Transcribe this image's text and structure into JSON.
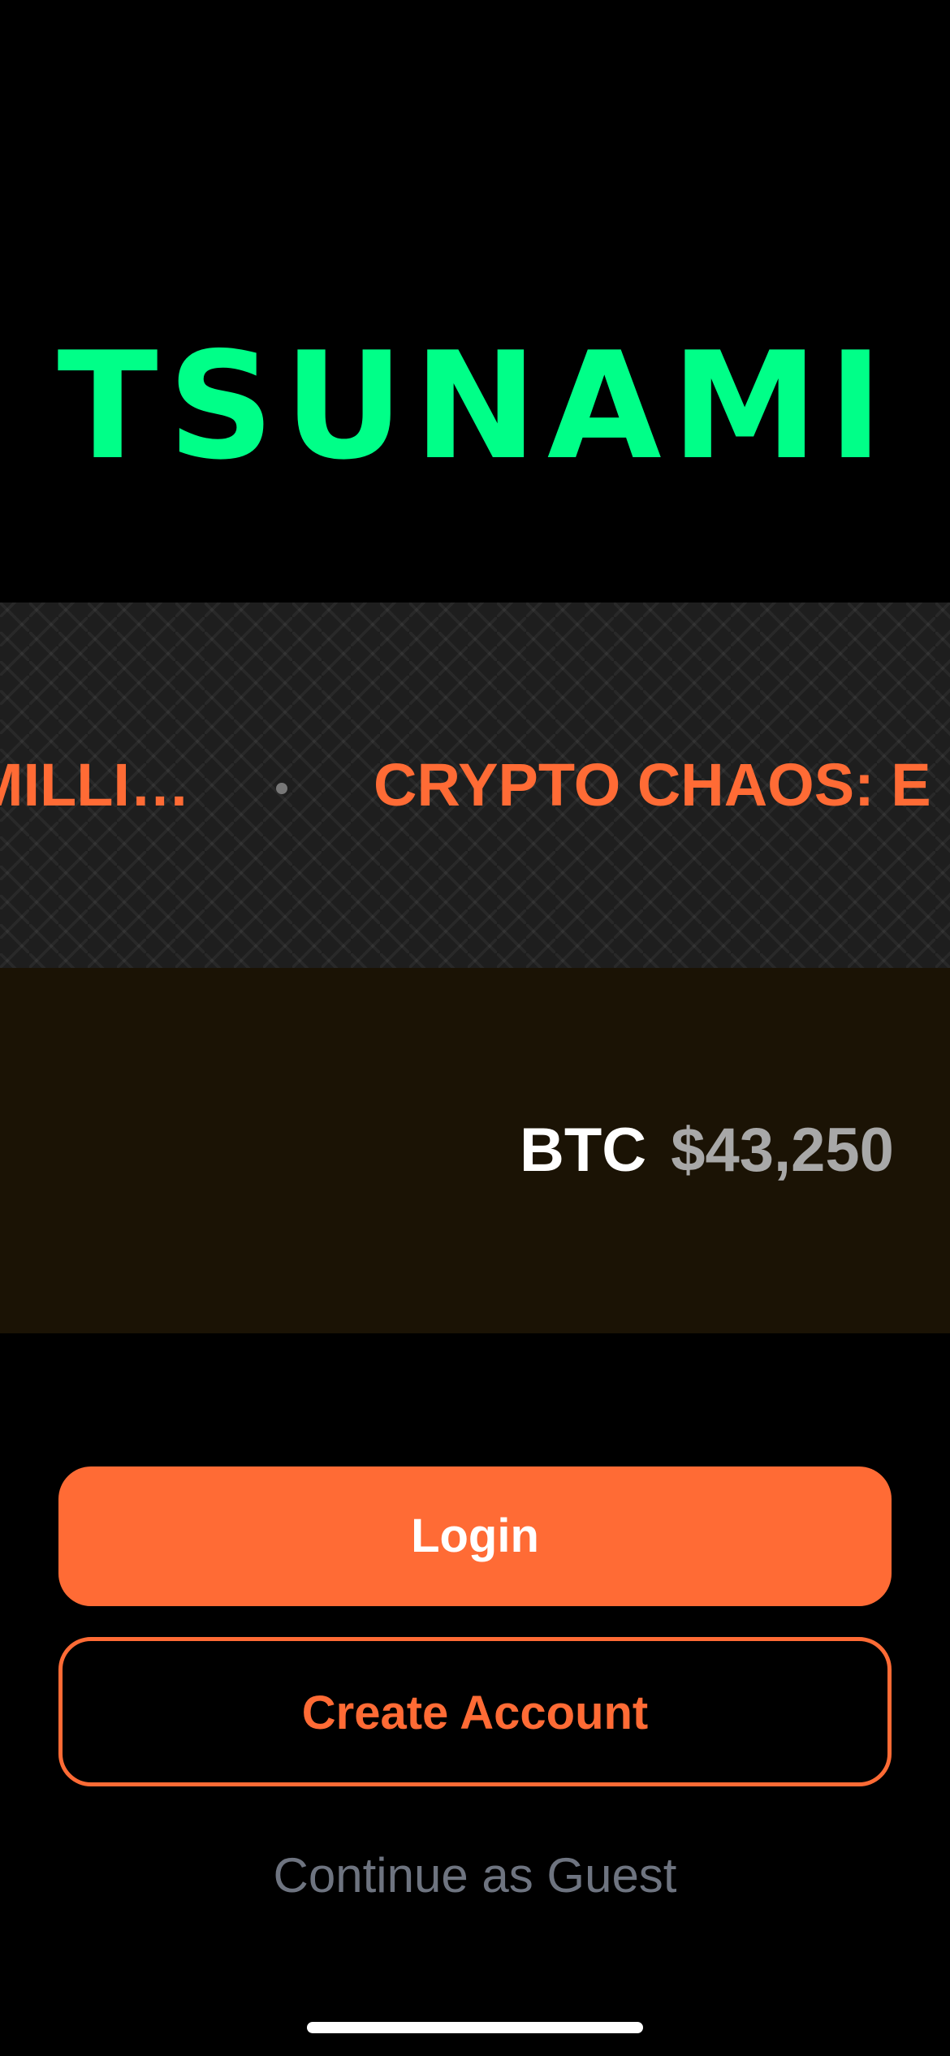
{
  "brand": {
    "logo_text": "TSUNAMI",
    "accent_color": "#00FF88"
  },
  "news_ticker": {
    "items": [
      "MILLI…",
      "CRYPTO CHAOS: E"
    ],
    "separator": "•",
    "text_color": "#FF6B35"
  },
  "price_ticker": {
    "symbol": "BTC",
    "price": "$43,250"
  },
  "actions": {
    "login_label": "Login",
    "create_account_label": "Create Account",
    "guest_label": "Continue as Guest",
    "primary_color": "#FF6B35"
  }
}
